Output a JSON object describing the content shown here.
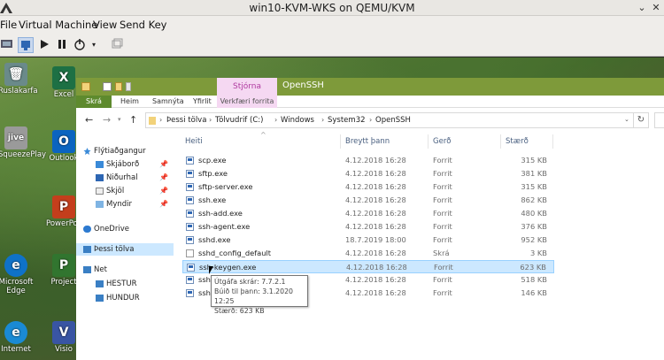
{
  "kvm": {
    "title": "win10-KVM-WKS on QEMU/KVM",
    "menu": [
      "File",
      "Virtual Machine",
      "View",
      "Send Key"
    ]
  },
  "desktop": {
    "icons": [
      {
        "label": "Ruslakarfa",
        "color": "#6a8a8a",
        "glyph": "🗑"
      },
      {
        "label": "Excel",
        "color": "#1d7044",
        "glyph": "X"
      },
      {
        "label": "SqueezePlay",
        "color": "#9a9a9a",
        "glyph": "jive"
      },
      {
        "label": "Outlook",
        "color": "#0b64c0",
        "glyph": "O"
      },
      {
        "label": "PowerPoint",
        "color": "#c43e1c",
        "glyph": "P"
      },
      {
        "label": "Microsoft Edge",
        "color": "#0f72c8",
        "glyph": "e"
      },
      {
        "label": "Project",
        "color": "#31752f",
        "glyph": "P"
      },
      {
        "label": "Internet",
        "color": "#1a8ad4",
        "glyph": "e"
      },
      {
        "label": "Visio",
        "color": "#3955a3",
        "glyph": "V"
      }
    ]
  },
  "explorer": {
    "context_tab": "Stjórna",
    "context_sub": "Verkfæri forrita",
    "window_title": "OpenSSH",
    "ribbon_tabs": [
      "Skrá",
      "Heim",
      "Samnýta",
      "Yfirlit"
    ],
    "breadcrumb": [
      "Þessi tölva",
      "Tölvudrif (C:)",
      "Windows",
      "System32",
      "OpenSSH"
    ],
    "nav": {
      "quick_access": "Flýtiaðgangur",
      "pinned": [
        "Skjáborð",
        "Niðurhal",
        "Skjöl",
        "Myndir"
      ],
      "onedrive": "OneDrive",
      "this_pc": "Þessi tölva",
      "network": "Net",
      "network_items": [
        "HESTUR",
        "HUNDUR"
      ]
    },
    "columns": {
      "name": "Heiti",
      "date": "Breytt þann",
      "type": "Gerð",
      "size": "Stærð"
    },
    "files": [
      {
        "name": "scp.exe",
        "date": "4.12.2018 16:28",
        "type": "Forrit",
        "size": "315 KB"
      },
      {
        "name": "sftp.exe",
        "date": "4.12.2018 16:28",
        "type": "Forrit",
        "size": "381 KB"
      },
      {
        "name": "sftp-server.exe",
        "date": "4.12.2018 16:28",
        "type": "Forrit",
        "size": "315 KB"
      },
      {
        "name": "ssh.exe",
        "date": "4.12.2018 16:28",
        "type": "Forrit",
        "size": "862 KB"
      },
      {
        "name": "ssh-add.exe",
        "date": "4.12.2018 16:28",
        "type": "Forrit",
        "size": "480 KB"
      },
      {
        "name": "ssh-agent.exe",
        "date": "4.12.2018 16:28",
        "type": "Forrit",
        "size": "376 KB"
      },
      {
        "name": "sshd.exe",
        "date": "18.7.2019 18:00",
        "type": "Forrit",
        "size": "952 KB"
      },
      {
        "name": "sshd_config_default",
        "date": "4.12.2018 16:28",
        "type": "Skrá",
        "size": "3 KB"
      },
      {
        "name": "ssh-keygen.exe",
        "date": "4.12.2018 16:28",
        "type": "Forrit",
        "size": "623 KB"
      },
      {
        "name": "ssh",
        "date": "4.12.2018 16:28",
        "type": "Forrit",
        "size": "518 KB"
      },
      {
        "name": "ssh",
        "date": "4.12.2018 16:28",
        "type": "Forrit",
        "size": "146 KB"
      }
    ],
    "selected_index": 8,
    "tooltip": {
      "line1": "Útgáfa skrár: 7.7.2.1",
      "line2": "Búið til þann: 3.1.2020 12:25",
      "line3": "Stærð: 623 KB"
    }
  }
}
